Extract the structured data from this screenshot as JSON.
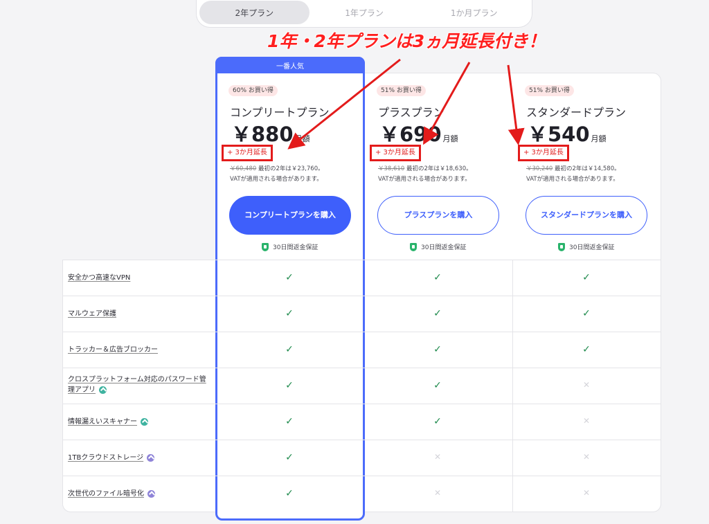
{
  "tabs": [
    {
      "label": "2年プラン",
      "active": true
    },
    {
      "label": "1年プラン",
      "active": false
    },
    {
      "label": "1か月プラン",
      "active": false
    }
  ],
  "annotation": "1年・2年プランは3ヵ月延長付き！",
  "popular_label": "一番人気",
  "plans": [
    {
      "badge": "60% お買い得",
      "name": "コンプリートプラン",
      "price": "￥880",
      "unit": "月額",
      "extension": "+ 3か月延長",
      "orig_price": "￥60,480",
      "orig_text": " 最初の2年は￥23,760。",
      "vat": "VATが適用される場合があります。",
      "button": "コンプリートプランを購入",
      "guarantee": "30日間返金保証"
    },
    {
      "badge": "51% お買い得",
      "name": "プラスプラン",
      "price": "￥690",
      "unit": "月額",
      "extension": "+ 3か月延長",
      "orig_price": "￥38,610",
      "orig_text": " 最初の2年は￥18,630。",
      "vat": "VATが適用される場合があります。",
      "button": "プラスプランを購入",
      "guarantee": "30日間返金保証"
    },
    {
      "badge": "51% お買い得",
      "name": "スタンダードプラン",
      "price": "￥540",
      "unit": "月額",
      "extension": "+ 3か月延長",
      "orig_price": "￥30,240",
      "orig_text": " 最初の2年は￥14,580。",
      "vat": "VATが適用される場合があります。",
      "button": "スタンダードプランを購入",
      "guarantee": "30日間返金保証"
    }
  ],
  "features": [
    {
      "label": "安全かつ高速なVPN",
      "icon": "",
      "marks": [
        true,
        true,
        true
      ]
    },
    {
      "label": "マルウェア保護",
      "icon": "",
      "marks": [
        true,
        true,
        true
      ]
    },
    {
      "label": "トラッカー＆広告ブロッカー",
      "icon": "",
      "marks": [
        true,
        true,
        true
      ]
    },
    {
      "label": "クロスプラットフォーム対応のパスワード管理アプリ",
      "icon": "teal",
      "marks": [
        true,
        true,
        false
      ]
    },
    {
      "label": "情報漏えいスキャナー",
      "icon": "teal",
      "marks": [
        true,
        true,
        false
      ]
    },
    {
      "label": "1TBクラウドストレージ",
      "icon": "purple",
      "marks": [
        true,
        false,
        false
      ]
    },
    {
      "label": "次世代のファイル暗号化",
      "icon": "purple",
      "marks": [
        true,
        false,
        false
      ]
    }
  ],
  "colors": {
    "accent": "#3e5ffb",
    "highlight_red": "#e31b1b",
    "check": "#1e8a4c"
  }
}
